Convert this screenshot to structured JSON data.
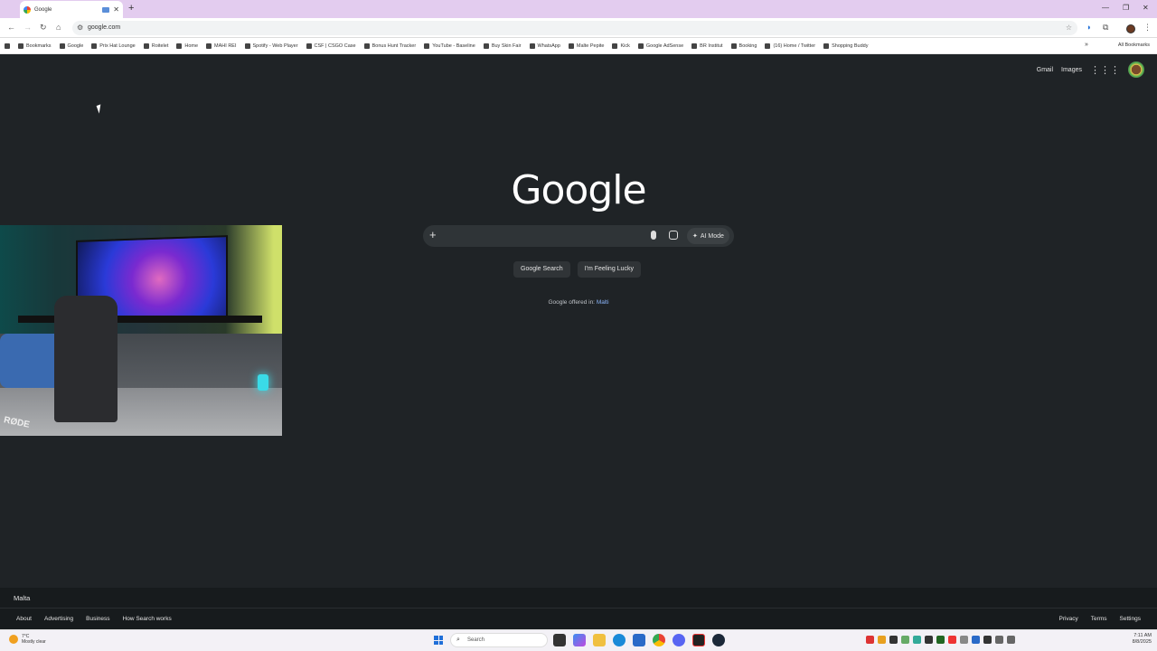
{
  "browser": {
    "tab_title": "Google",
    "url": "google.com",
    "bookmarks": [
      "Bookmarks",
      "Google",
      "Prix Hat Lounge",
      "Roitelet",
      "Home",
      "MAHI REI",
      "Spotify - Web Player",
      "CSF | CSGO Case",
      "Bonus Hunt Tracker",
      "YouTube - Baseline",
      "Buy Skin Fair",
      "WhatsApp",
      "Malte Pepite",
      "Kick",
      "Google AdSense",
      "BR Institut",
      "Booking",
      "(16) Home / Twitter",
      "Shopping Buddy"
    ],
    "all_bookmarks": "All Bookmarks"
  },
  "google": {
    "gmail": "Gmail",
    "images": "Images",
    "logo": "Google",
    "search_placeholder": "",
    "ai_mode": "AI Mode",
    "search_button": "Google Search",
    "lucky_button": "I'm Feeling Lucky",
    "offered_prefix": "Google offered in: ",
    "offered_lang": "Malti",
    "country": "Malta",
    "footer_left": [
      "About",
      "Advertising",
      "Business",
      "How Search works"
    ],
    "footer_right": [
      "Privacy",
      "Terms",
      "Settings"
    ]
  },
  "taskbar": {
    "temp": "7°C",
    "weather": "Mostly clear",
    "search": "Search",
    "time": "7:11 AM",
    "date": "8/8/2025"
  },
  "colors": {
    "accent": "#e3ccef",
    "page_bg": "#1f2326",
    "link": "#8ab4f8"
  }
}
